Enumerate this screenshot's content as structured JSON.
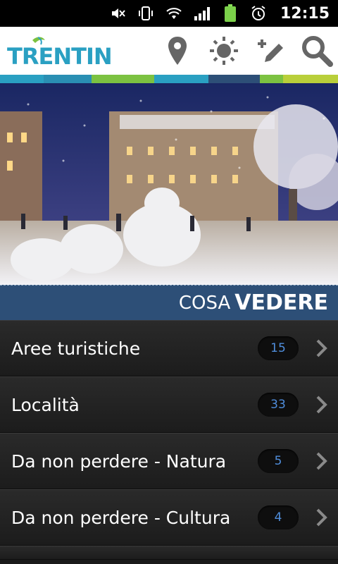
{
  "statusbar": {
    "icons": [
      "mute-icon",
      "vibrate-icon",
      "wifi-icon",
      "signal-icon",
      "battery-icon",
      "alarm-icon"
    ],
    "time": "12:15"
  },
  "header": {
    "logo_text": "TRENTINO",
    "icons": [
      "map-pin-icon",
      "weather-sun-icon",
      "pencil-add-icon",
      "search-icon"
    ]
  },
  "colors": {
    "colorbar": [
      "#2aa0c2",
      "#2aa0c2",
      "#7cc241",
      "#2aa0c2",
      "#2d4f77",
      "#7cc241",
      "#b9cf3a",
      "#2aa0c2"
    ]
  },
  "section": {
    "light": "COSA",
    "bold": "VEDERE"
  },
  "items": [
    {
      "label": "Aree turistiche",
      "count": "15"
    },
    {
      "label": "Località",
      "count": "33"
    },
    {
      "label": "Da non perdere - Natura",
      "count": "5"
    },
    {
      "label": "Da non perdere - Cultura",
      "count": "4"
    }
  ]
}
